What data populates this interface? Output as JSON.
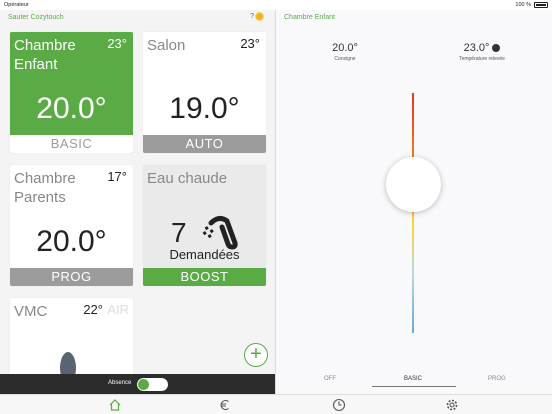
{
  "status_bar": {
    "operator": "Opérateur",
    "time": "",
    "battery": "100 %"
  },
  "left_panel": {
    "title": "Sauter Cozytouch",
    "help": "?",
    "tiles": [
      {
        "name": "Chambre\nEnfant",
        "temp": "23°",
        "target": "20.0°",
        "mode": "BASIC"
      },
      {
        "name": "Salon",
        "temp": "23°",
        "target": "19.0°",
        "mode": "AUTO"
      },
      {
        "name": "Chambre\nParents",
        "temp": "17°",
        "target": "20.0°",
        "mode": "PROG"
      },
      {
        "name": "Eau chaude",
        "count": "7",
        "label": "Demandées",
        "mode": "BOOST"
      },
      {
        "name": "VMC",
        "temp": "22°",
        "extra": "AIR"
      }
    ],
    "absence_label": "Absence"
  },
  "right_panel": {
    "title": "Chambre Enfant",
    "setpoint": {
      "value": "20.0°",
      "label": "Consigne"
    },
    "measured": {
      "value": "23.0°",
      "label": "Température relevée"
    },
    "modes": [
      "OFF",
      "BASIC",
      "PROG"
    ],
    "selected_mode": "BASIC"
  },
  "colors": {
    "accent": "#5aab45",
    "mode_grey": "#9b9b9b",
    "dark_bar": "#2c2c2c"
  }
}
